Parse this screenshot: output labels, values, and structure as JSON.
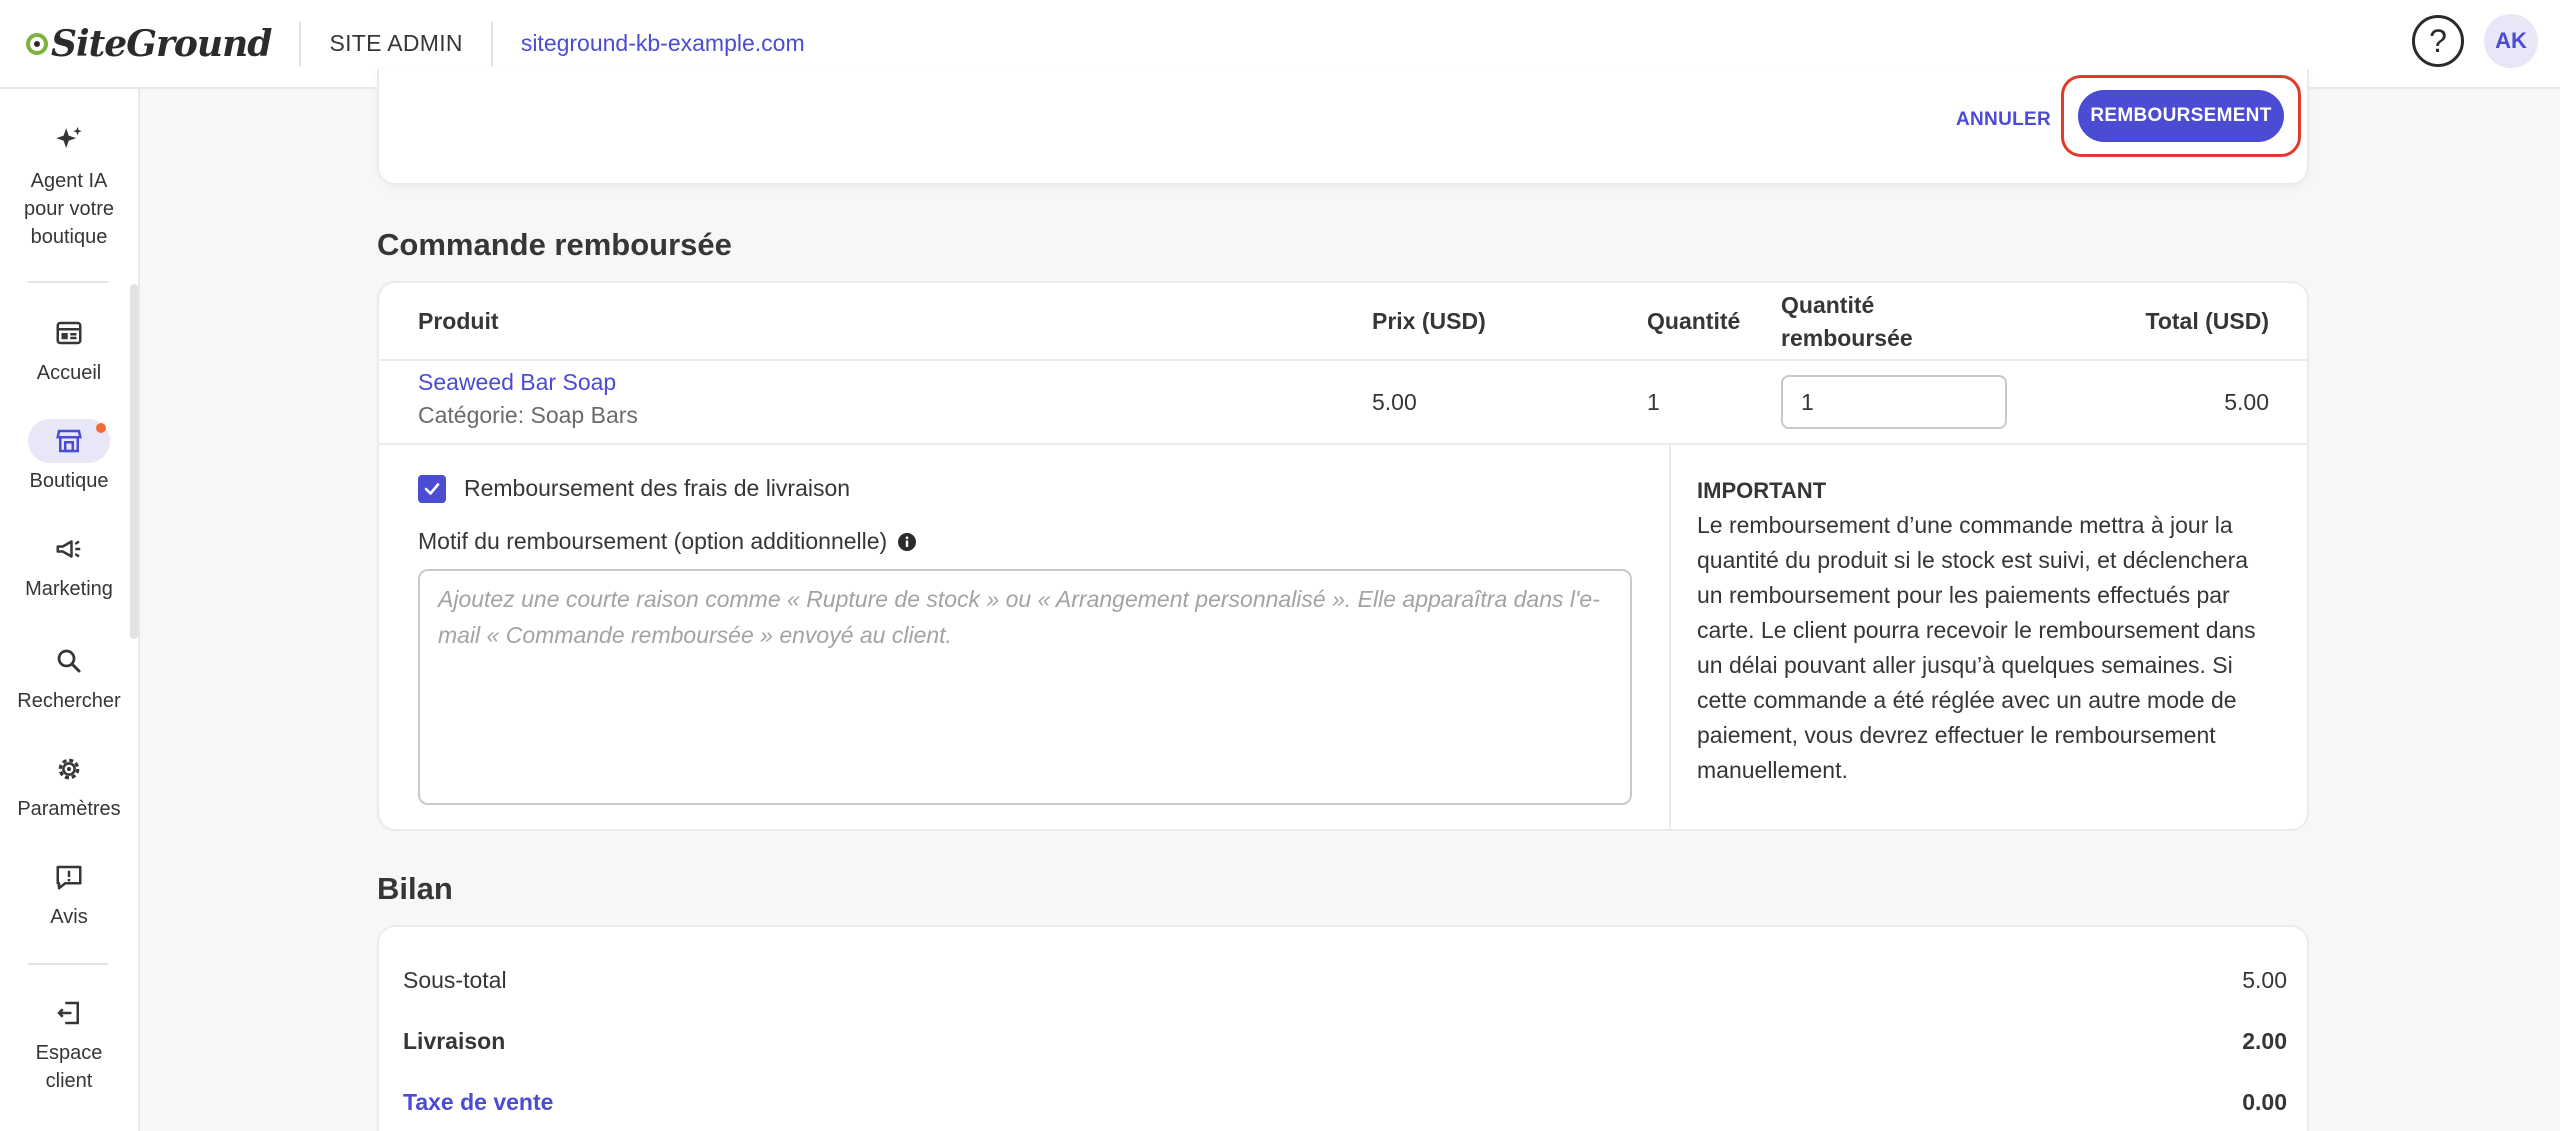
{
  "header": {
    "logo_text": "SiteGround",
    "section": "SITE ADMIN",
    "site_url": "siteground-kb-example.com",
    "help_symbol": "?",
    "avatar_initials": "AK"
  },
  "sidebar": {
    "items": [
      {
        "label": "Agent IA pour votre boutique",
        "icon": "sparkle-icon"
      },
      {
        "label": "Accueil",
        "icon": "dashboard-icon"
      },
      {
        "label": "Boutique",
        "icon": "store-icon",
        "active": true
      },
      {
        "label": "Marketing",
        "icon": "megaphone-icon"
      },
      {
        "label": "Rechercher",
        "icon": "search-icon"
      },
      {
        "label": "Paramètres",
        "icon": "gear-icon"
      },
      {
        "label": "Avis",
        "icon": "review-icon"
      },
      {
        "label": "Espace client",
        "icon": "logout-icon"
      }
    ]
  },
  "actions": {
    "cancel_label": "ANNULER",
    "refund_label": "REMBOURSEMENT"
  },
  "refunded_order": {
    "title": "Commande remboursée",
    "columns": {
      "product": "Produit",
      "price": "Prix (USD)",
      "quantity": "Quantité",
      "refunded_qty_line1": "Quantité",
      "refunded_qty_line2": "remboursée",
      "total": "Total (USD)"
    },
    "row": {
      "product_name": "Seaweed Bar Soap",
      "category": "Catégorie: Soap Bars",
      "price": "5.00",
      "quantity": "1",
      "refunded_qty": "1",
      "total": "5.00"
    },
    "shipping_refund_label": "Remboursement des frais de livraison",
    "shipping_refund_checked": true,
    "reason_label": "Motif du remboursement (option additionnelle)",
    "reason_placeholder": "Ajoutez une courte raison comme « Rupture de stock » ou « Arrangement personnalisé ». Elle apparaîtra dans l'e-mail « Commande remboursée » envoyé au client.",
    "important_title": "IMPORTANT",
    "important_text": "Le remboursement d’une commande mettra à jour la quantité du produit si le stock est suivi, et déclenchera un remboursement pour les paiements effectués par carte. Le client pourra recevoir le remboursement dans un délai pouvant aller jusqu’à quelques semaines. Si cette commande a été réglée avec un autre mode de paiement, vous devrez effectuer le remboursement manuellement."
  },
  "summary": {
    "title": "Bilan",
    "subtotal_label": "Sous-total",
    "subtotal_value": "5.00",
    "shipping_label": "Livraison",
    "shipping_value": "2.00",
    "tax_label": "Taxe de vente",
    "tax_value": "0.00"
  },
  "colors": {
    "accent": "#4b4bd3",
    "highlight_ring": "#e03a2e",
    "notification_dot": "#f26b38"
  }
}
